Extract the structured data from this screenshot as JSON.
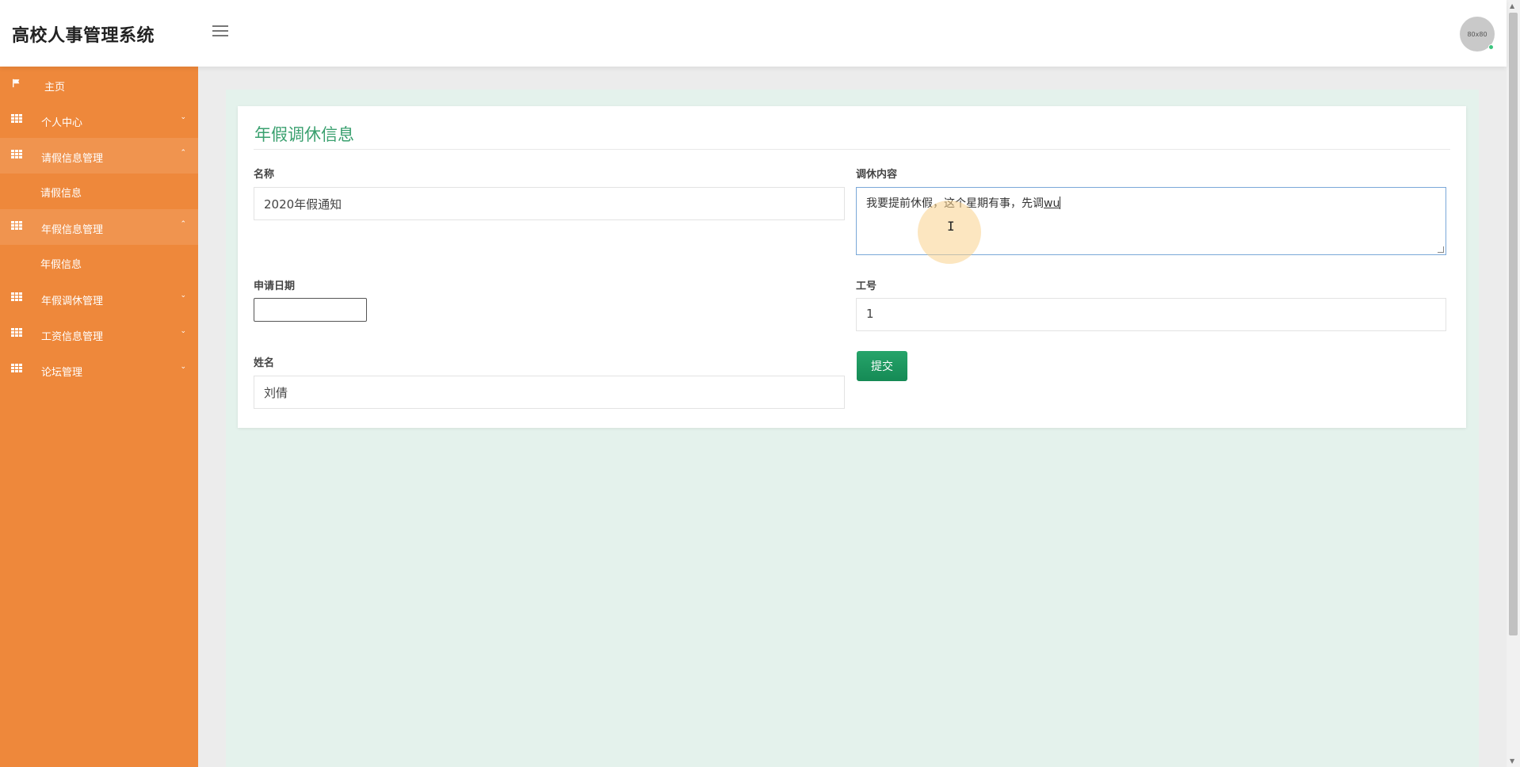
{
  "header": {
    "brand": "高校人事管理系统",
    "avatar_text": "80x80"
  },
  "sidebar": {
    "items": [
      {
        "label": "主页",
        "icon": "flag-icon"
      },
      {
        "label": "个人中心",
        "icon": "grid-icon",
        "caret": "⌄"
      },
      {
        "label": "请假信息管理",
        "icon": "grid-icon",
        "caret": "⌃",
        "sub": "请假信息"
      },
      {
        "label": "年假信息管理",
        "icon": "grid-icon",
        "caret": "⌃",
        "sub": "年假信息"
      },
      {
        "label": "年假调休管理",
        "icon": "grid-icon",
        "caret": "⌄"
      },
      {
        "label": "工资信息管理",
        "icon": "grid-icon",
        "caret": "⌄"
      },
      {
        "label": "论坛管理",
        "icon": "grid-icon",
        "caret": "⌄"
      }
    ]
  },
  "form": {
    "title": "年假调休信息",
    "name_label": "名称",
    "name_value": "2020年假通知",
    "content_label": "调休内容",
    "content_value": "我要提前休假，这个星期有事，先调",
    "content_composing": "wu",
    "date_label": "申请日期",
    "date_value": "",
    "empno_label": "工号",
    "empno_value": "1",
    "person_label": "姓名",
    "person_value": "刘倩",
    "submit_label": "提交"
  },
  "colors": {
    "sidebar": "#ee883b",
    "accent_green": "#3aa06f",
    "button_green": "#1b9a5e"
  }
}
